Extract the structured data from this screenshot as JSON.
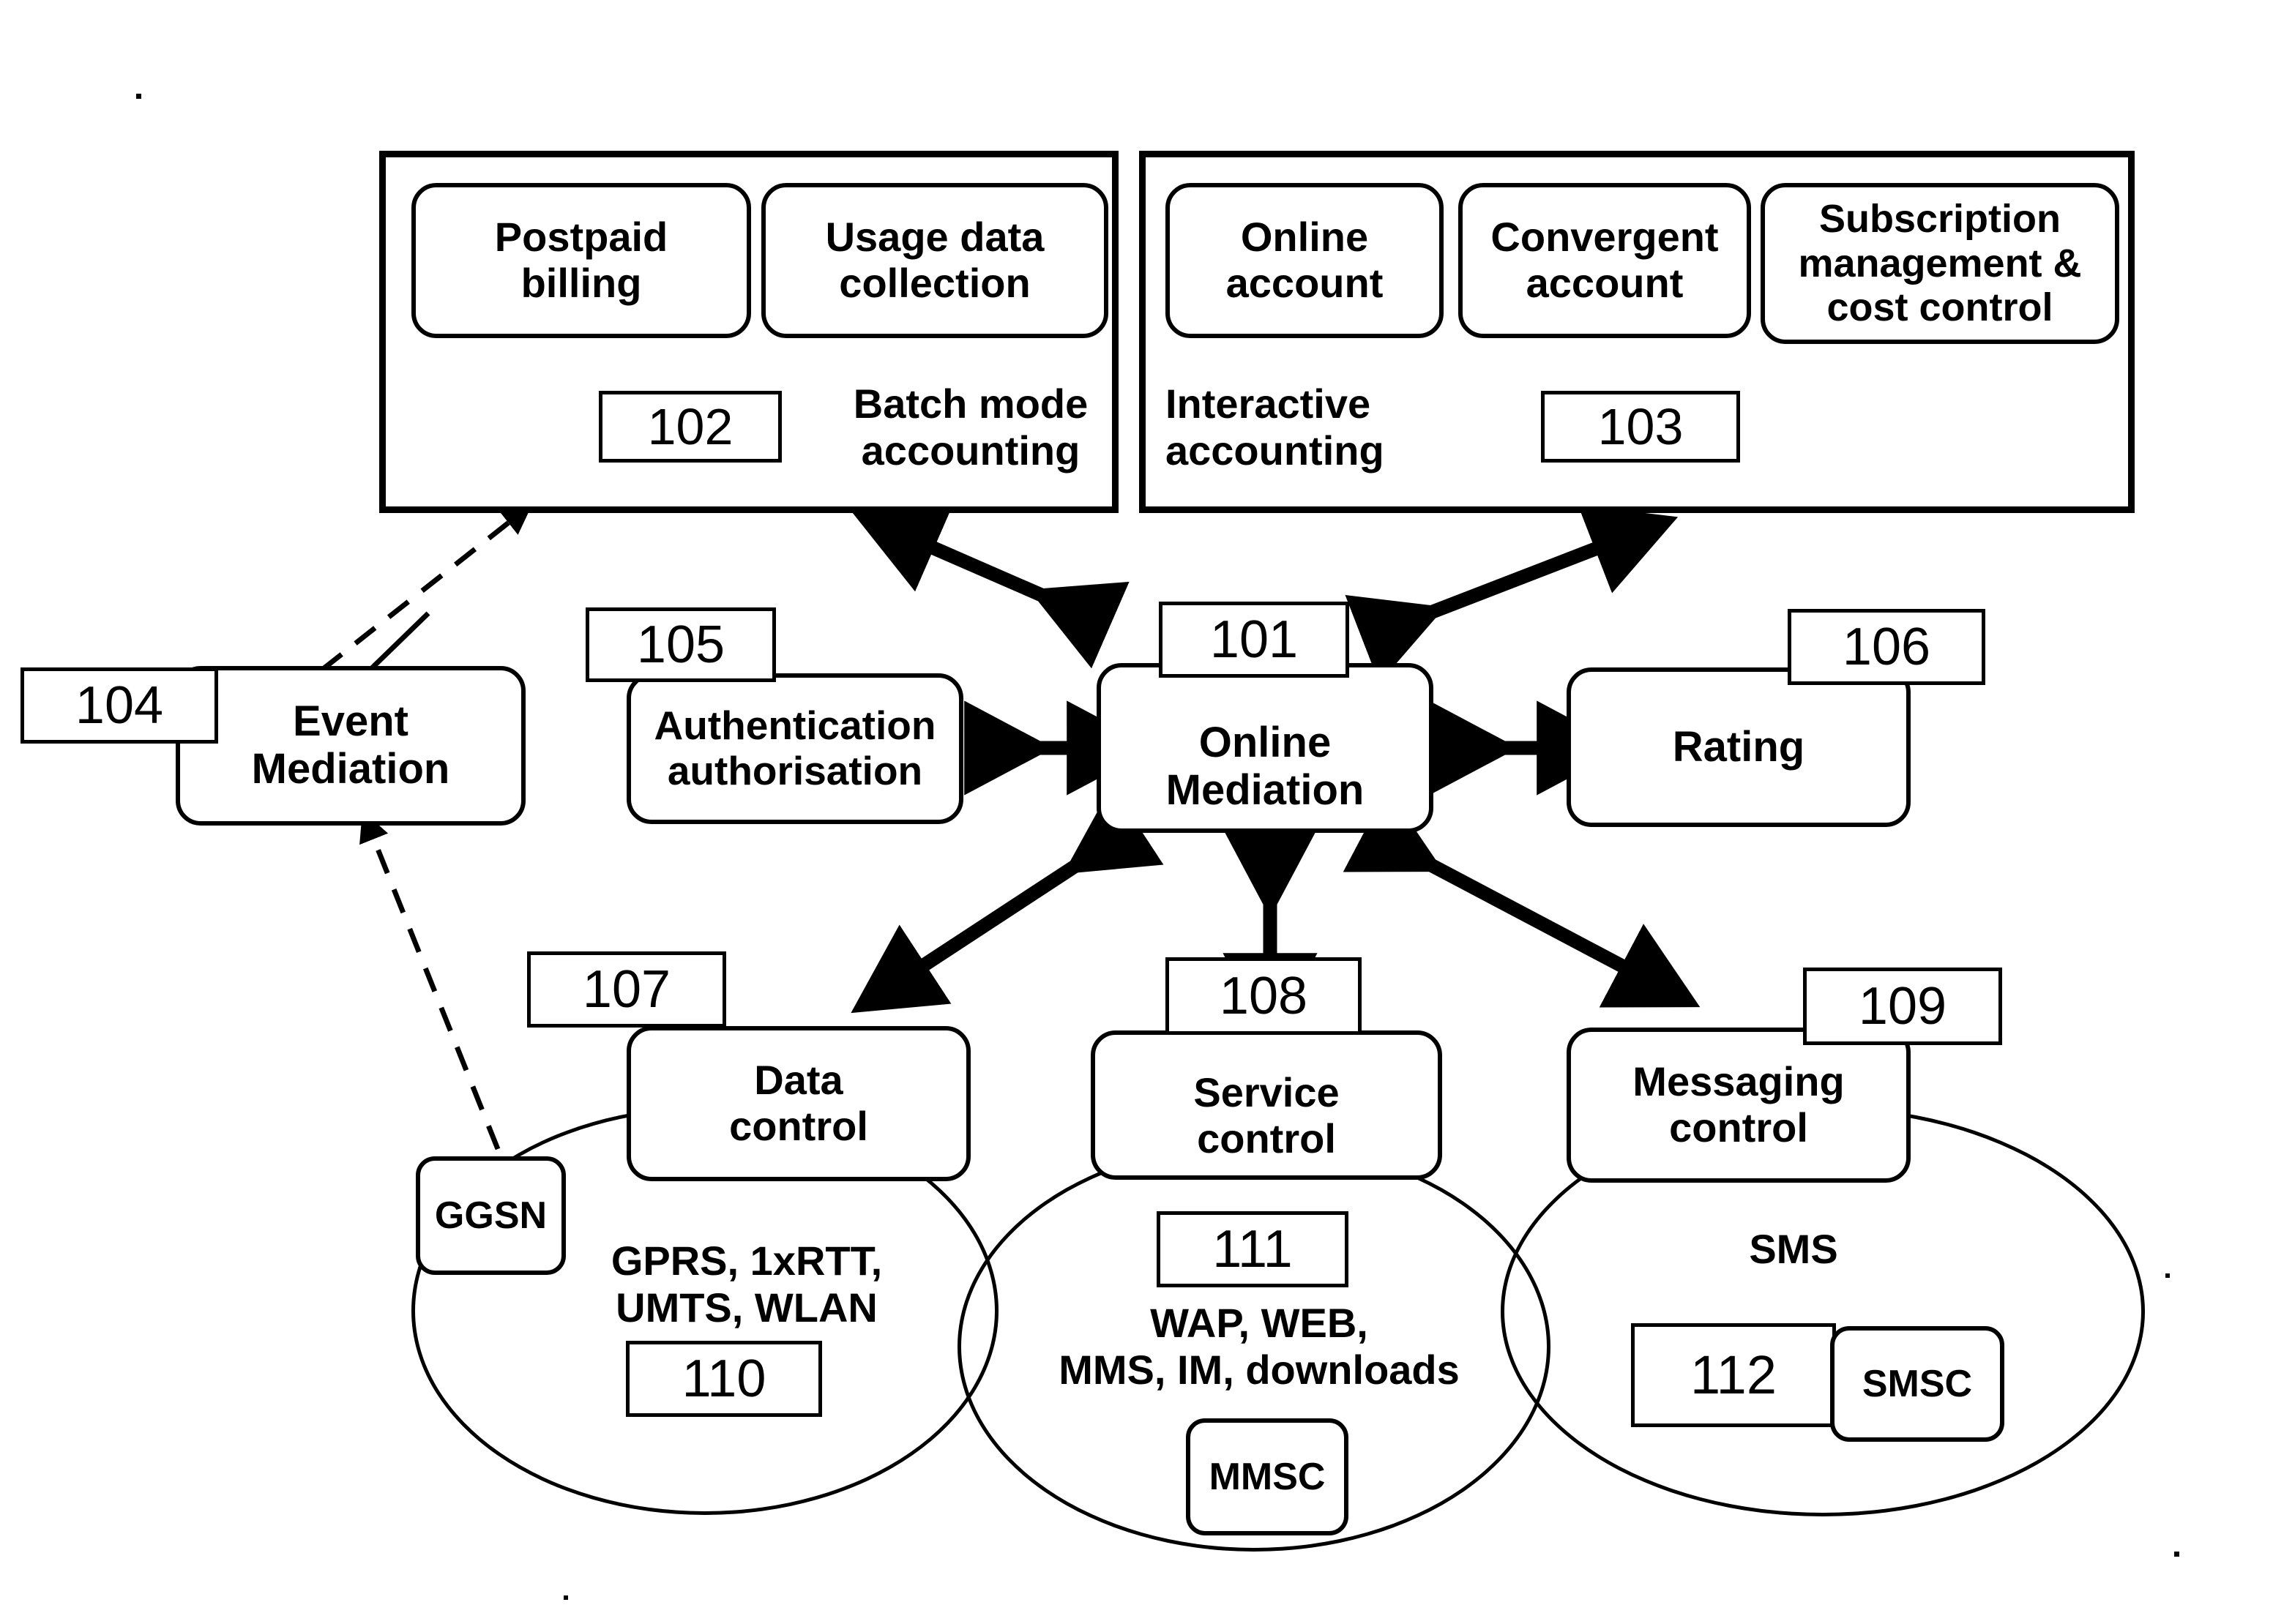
{
  "figure": {
    "type": "patent-block-diagram",
    "title": "Convergent online mediation architecture"
  },
  "groups": [
    {
      "id": "batch",
      "ref": "102",
      "caption": "Batch mode\naccounting",
      "boxes": [
        {
          "ref_label": "postpaid-billing",
          "text": "Postpaid\nbilling"
        },
        {
          "ref_label": "usage-data-collection",
          "text": "Usage data\ncollection"
        }
      ]
    },
    {
      "id": "interactive",
      "ref": "103",
      "caption": "Interactive\naccounting",
      "boxes": [
        {
          "ref_label": "online-account",
          "text": "Online\naccount"
        },
        {
          "ref_label": "convergent-account",
          "text": "Convergent\naccount"
        },
        {
          "ref_label": "subscription-management",
          "text": "Subscription\nmanagement &\ncost control"
        }
      ]
    }
  ],
  "nodes": {
    "event_mediation": {
      "ref": "104",
      "text": "Event\nMediation"
    },
    "authentication": {
      "ref": "105",
      "text": "Authentication\nauthorisation"
    },
    "online_mediation": {
      "ref": "101",
      "text": "Online\nMediation"
    },
    "rating": {
      "ref": "106",
      "text": "Rating"
    },
    "data_control": {
      "ref": "107",
      "text": "Data\ncontrol"
    },
    "service_control": {
      "ref": "108",
      "text": "Service\ncontrol"
    },
    "messaging_control": {
      "ref": "109",
      "text": "Messaging\ncontrol"
    }
  },
  "networks": [
    {
      "id": "data-network",
      "ref": "110",
      "text": "GPRS, 1xRTT,\nUMTS, WLAN",
      "element": "GGSN"
    },
    {
      "id": "service-network",
      "ref": "111",
      "text": "WAP, WEB,\nMMS, IM, downloads",
      "element": "MMSC"
    },
    {
      "id": "messaging-network",
      "ref": "112",
      "text": "SMS",
      "element": "SMSC"
    }
  ],
  "colors": {
    "ink": "#000000",
    "paper": "#ffffff"
  }
}
